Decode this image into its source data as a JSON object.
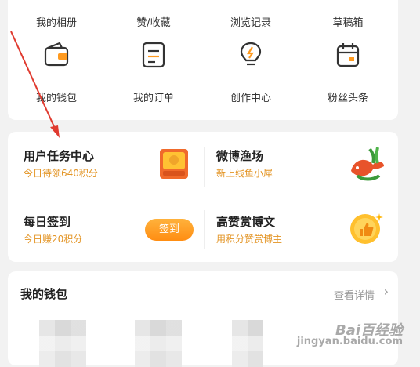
{
  "top_links": [
    "我的相册",
    "赞/收藏",
    "浏览记录",
    "草稿箱"
  ],
  "icon_menu": [
    {
      "label": "我的钱包",
      "icon": "wallet-icon"
    },
    {
      "label": "我的订单",
      "icon": "order-list-icon"
    },
    {
      "label": "创作中心",
      "icon": "lightbulb-icon"
    },
    {
      "label": "粉丝头条",
      "icon": "calendar-icon"
    }
  ],
  "tasks": {
    "user_task": {
      "title": "用户任务中心",
      "subtitle": "今日待领640积分"
    },
    "weibo_fishing": {
      "title": "微博渔场",
      "subtitle": "新上线鱼小犀"
    },
    "checkin": {
      "title": "每日签到",
      "subtitle": "今日赚20积分",
      "button": "签到"
    },
    "reward_post": {
      "title": "高赞赏博文",
      "subtitle": "用积分赞赏博主"
    }
  },
  "wallet": {
    "title": "我的钱包",
    "more": "查看详情"
  },
  "watermark": {
    "line1": "Bai百经验",
    "line2": "jingyan.baidu.com"
  },
  "colors": {
    "accent": "#ff9a1f",
    "subtitle": "#e39424",
    "arrow": "#e03a2f"
  }
}
